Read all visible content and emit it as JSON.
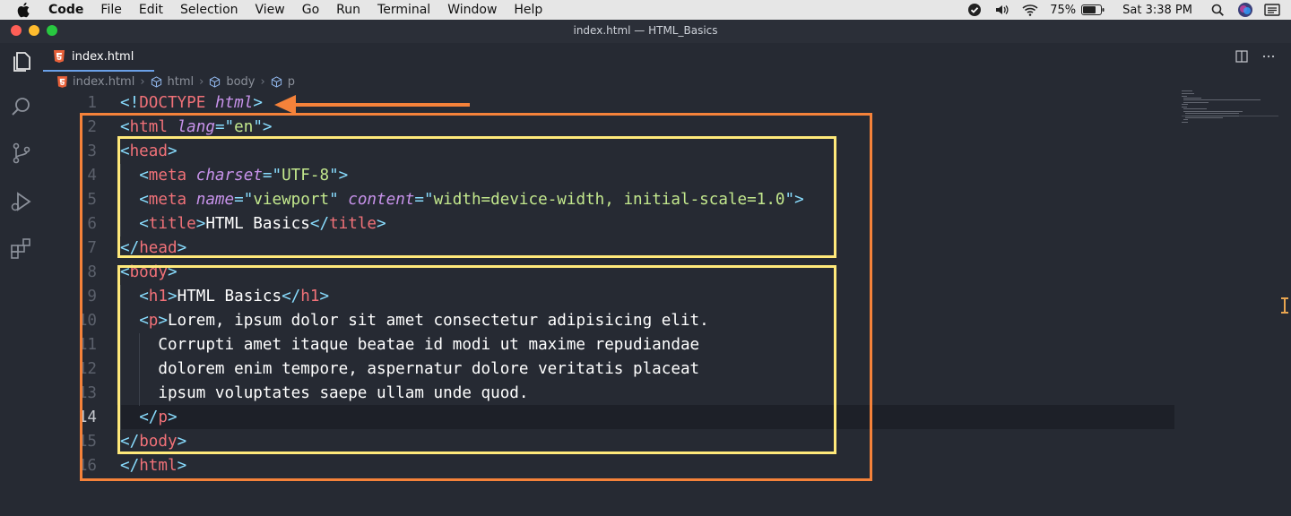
{
  "menubar": {
    "app": "Code",
    "items": [
      "File",
      "Edit",
      "Selection",
      "View",
      "Go",
      "Run",
      "Terminal",
      "Window",
      "Help"
    ],
    "battery_percent": "75%",
    "clock": "Sat 3:38 PM"
  },
  "window": {
    "title": "index.html — HTML_Basics"
  },
  "tab": {
    "label": "index.html",
    "icon": "html5-icon"
  },
  "breadcrumbs": [
    "index.html",
    "html",
    "body",
    "p"
  ],
  "editor": {
    "line_numbers": [
      "1",
      "2",
      "3",
      "4",
      "5",
      "6",
      "7",
      "8",
      "9",
      "10",
      "11",
      "12",
      "13",
      "14",
      "15",
      "16"
    ],
    "current_line": "14",
    "lines": [
      [
        [
          "p",
          "<!"
        ],
        [
          "k",
          "DOCTYPE"
        ],
        [
          "w",
          " "
        ],
        [
          "a",
          "html"
        ],
        [
          "p",
          ">"
        ]
      ],
      [
        [
          "p",
          "<"
        ],
        [
          "t",
          "html"
        ],
        [
          "w",
          " "
        ],
        [
          "a",
          "lang"
        ],
        [
          "p",
          "=\""
        ],
        [
          "s",
          "en"
        ],
        [
          "p",
          "\">"
        ]
      ],
      [
        [
          "p",
          "<"
        ],
        [
          "t",
          "head"
        ],
        [
          "p",
          ">"
        ]
      ],
      [
        [
          "w",
          "  "
        ],
        [
          "p",
          "<"
        ],
        [
          "t",
          "meta"
        ],
        [
          "w",
          " "
        ],
        [
          "a",
          "charset"
        ],
        [
          "p",
          "=\""
        ],
        [
          "s",
          "UTF-8"
        ],
        [
          "p",
          "\">"
        ]
      ],
      [
        [
          "w",
          "  "
        ],
        [
          "p",
          "<"
        ],
        [
          "t",
          "meta"
        ],
        [
          "w",
          " "
        ],
        [
          "a",
          "name"
        ],
        [
          "p",
          "=\""
        ],
        [
          "s",
          "viewport"
        ],
        [
          "p",
          "\""
        ],
        [
          "w",
          " "
        ],
        [
          "a",
          "content"
        ],
        [
          "p",
          "=\""
        ],
        [
          "s",
          "width=device-width, initial-scale=1.0"
        ],
        [
          "p",
          "\">"
        ]
      ],
      [
        [
          "w",
          "  "
        ],
        [
          "p",
          "<"
        ],
        [
          "t",
          "title"
        ],
        [
          "p",
          ">"
        ],
        [
          "w",
          "HTML Basics"
        ],
        [
          "p",
          "</"
        ],
        [
          "t",
          "title"
        ],
        [
          "p",
          ">"
        ]
      ],
      [
        [
          "p",
          "</"
        ],
        [
          "t",
          "head"
        ],
        [
          "p",
          ">"
        ]
      ],
      [
        [
          "p",
          "<"
        ],
        [
          "t",
          "body"
        ],
        [
          "p",
          ">"
        ]
      ],
      [
        [
          "w",
          "  "
        ],
        [
          "p",
          "<"
        ],
        [
          "t",
          "h1"
        ],
        [
          "p",
          ">"
        ],
        [
          "w",
          "HTML Basics"
        ],
        [
          "p",
          "</"
        ],
        [
          "t",
          "h1"
        ],
        [
          "p",
          ">"
        ]
      ],
      [
        [
          "w",
          "  "
        ],
        [
          "p",
          "<"
        ],
        [
          "t",
          "p"
        ],
        [
          "p",
          ">"
        ],
        [
          "w",
          "Lorem, ipsum dolor sit amet consectetur adipisicing elit."
        ]
      ],
      [
        [
          "w",
          "    Corrupti amet itaque beatae id modi ut maxime repudiandae"
        ]
      ],
      [
        [
          "w",
          "    dolorem enim tempore, aspernatur dolore veritatis placeat"
        ]
      ],
      [
        [
          "w",
          "    ipsum voluptates saepe ullam unde quod."
        ]
      ],
      [
        [
          "w",
          "  "
        ],
        [
          "p",
          "</"
        ],
        [
          "t",
          "p"
        ],
        [
          "p",
          ">"
        ]
      ],
      [
        [
          "p",
          "</"
        ],
        [
          "t",
          "body"
        ],
        [
          "p",
          ">"
        ]
      ],
      [
        [
          "p",
          "</"
        ],
        [
          "t",
          "html"
        ],
        [
          "p",
          ">"
        ]
      ]
    ]
  },
  "colors": {
    "annotation_outer": "#f5823a",
    "annotation_inner": "#ffe97a",
    "tag": "#f07178",
    "attribute": "#c792ea",
    "string": "#c3e88d",
    "punctuation": "#89ddff"
  }
}
